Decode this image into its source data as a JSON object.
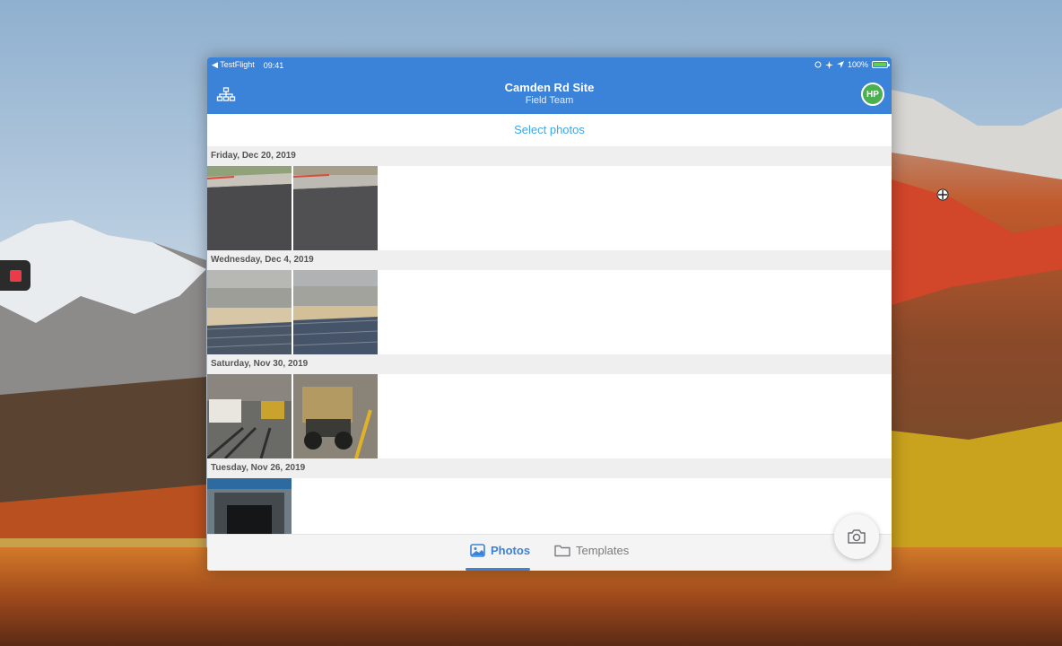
{
  "status_bar": {
    "back_app": "◀ TestFlight",
    "time": "09:41",
    "battery": "100%",
    "icons": [
      "rotation-lock-icon",
      "airplane-icon",
      "location-icon",
      "battery-icon"
    ]
  },
  "header": {
    "title": "Camden Rd Site",
    "subtitle": "Field Team",
    "avatar_initials": "HP",
    "left_icon": "site-hierarchy-icon"
  },
  "select_link": "Select photos",
  "feed": {
    "sections": [
      {
        "date": "Friday, Dec 20, 2019",
        "photo_count": 2
      },
      {
        "date": "Wednesday, Dec 4, 2019",
        "photo_count": 2
      },
      {
        "date": "Saturday, Nov 30, 2019",
        "photo_count": 2
      },
      {
        "date": "Tuesday, Nov 26, 2019",
        "photo_count": 1
      }
    ]
  },
  "tabs": [
    {
      "label": "Photos",
      "icon": "image-icon",
      "active": true
    },
    {
      "label": "Templates",
      "icon": "folder-icon",
      "active": false
    }
  ],
  "fab": {
    "icon": "camera-icon"
  },
  "colors": {
    "header_blue": "#3b82d9",
    "link_blue": "#40a6e6",
    "avatar_green": "#4caf50",
    "section_bg": "#efefef"
  }
}
